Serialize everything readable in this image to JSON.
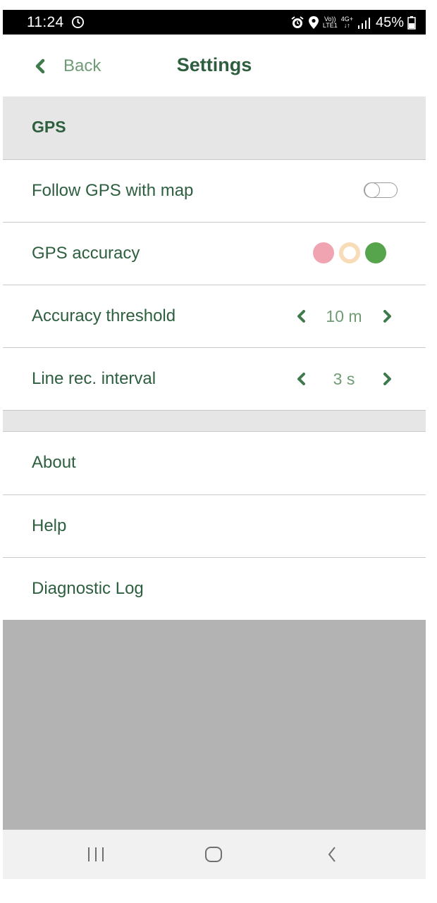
{
  "status_bar": {
    "time": "11:24",
    "network_top": "Vo))",
    "network_bottom": "LTE1",
    "network_type": "4G+",
    "battery": "45%",
    "icons": [
      "clock-icon",
      "alarm-icon",
      "location-icon",
      "signal-icon",
      "battery-icon"
    ]
  },
  "header": {
    "back_label": "Back",
    "title": "Settings",
    "back_icon": "chevron-left-icon"
  },
  "gps_section": {
    "title": "GPS",
    "follow_gps": {
      "label": "Follow GPS with map",
      "enabled": false
    },
    "gps_accuracy": {
      "label": "GPS accuracy",
      "dots": [
        {
          "state": "low",
          "color": "#f0a3b1"
        },
        {
          "state": "medium",
          "color": "#f8dcb8"
        },
        {
          "state": "high",
          "color": "#56a44c"
        }
      ]
    },
    "accuracy_threshold": {
      "label": "Accuracy threshold",
      "value": "10 m"
    },
    "line_interval": {
      "label": "Line rec. interval",
      "value": "3 s"
    }
  },
  "other_section": {
    "items": [
      {
        "label": "About"
      },
      {
        "label": "Help"
      },
      {
        "label": "Diagnostic Log"
      }
    ]
  },
  "nav_bar": {
    "buttons": [
      "recents-icon",
      "home-icon",
      "back-icon"
    ]
  },
  "colors": {
    "primary_text": "#2d5f3f",
    "secondary_text": "#6f9c76",
    "section_bg": "#e6e6e6",
    "empty_area": "#b3b3b3"
  }
}
